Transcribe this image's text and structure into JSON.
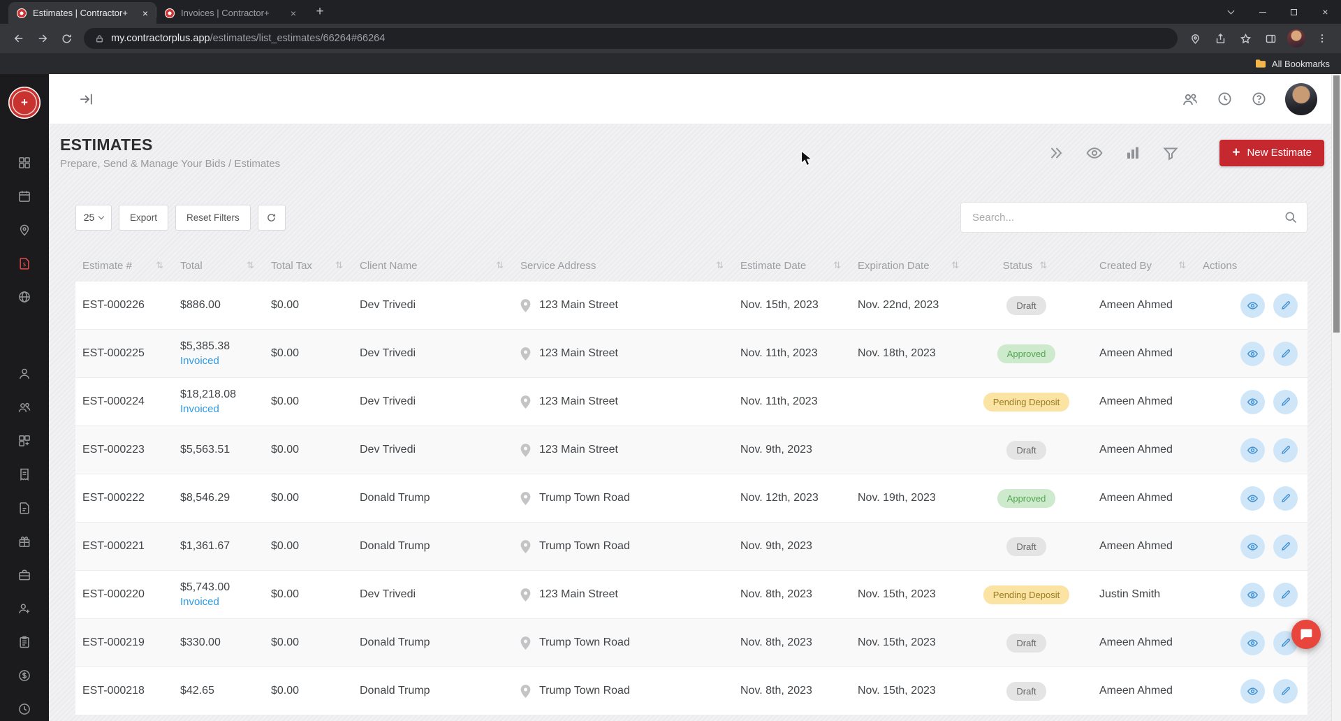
{
  "browser": {
    "tabs": [
      {
        "title": "Estimates | Contractor+",
        "active": true
      },
      {
        "title": "Invoices | Contractor+",
        "active": false
      }
    ],
    "url": {
      "domain": "my.contractorplus.app",
      "path": "/estimates/list_estimates/66264#66264"
    },
    "bookmarks": {
      "all_bookmarks_label": "All Bookmarks"
    }
  },
  "sidebar": {
    "items": [
      {
        "id": "dashboard",
        "icon": "dashboard-icon"
      },
      {
        "id": "schedule",
        "icon": "calendar-icon"
      },
      {
        "id": "jobs",
        "icon": "map-pin-icon"
      },
      {
        "id": "estimates",
        "icon": "estimate-document-icon",
        "active": true
      },
      {
        "id": "network",
        "icon": "globe-icon"
      },
      {
        "id": "clients",
        "icon": "client-icon",
        "gap": true
      },
      {
        "id": "team",
        "icon": "team-icon"
      },
      {
        "id": "items",
        "icon": "items-grid-icon"
      },
      {
        "id": "invoices",
        "icon": "invoice-icon"
      },
      {
        "id": "payments",
        "icon": "payment-document-icon"
      },
      {
        "id": "supplies",
        "icon": "gift-box-icon"
      },
      {
        "id": "tools",
        "icon": "briefcase-icon"
      },
      {
        "id": "leads",
        "icon": "person-add-icon"
      },
      {
        "id": "tasks",
        "icon": "clipboard-icon"
      },
      {
        "id": "expenses",
        "icon": "dollar-coin-icon"
      },
      {
        "id": "timeclock",
        "icon": "clock-icon"
      }
    ]
  },
  "page": {
    "title": "ESTIMATES",
    "subtitle": "Prepare, Send & Manage Your Bids / Estimates",
    "new_estimate_label": "New Estimate"
  },
  "controls": {
    "page_size": "25",
    "export_label": "Export",
    "reset_filters_label": "Reset Filters",
    "search_placeholder": "Search..."
  },
  "table": {
    "invoiced_label": "Invoiced",
    "columns": [
      {
        "key": "est",
        "label": "Estimate #",
        "sortable": true
      },
      {
        "key": "total",
        "label": "Total",
        "sortable": true
      },
      {
        "key": "tax",
        "label": "Total Tax",
        "sortable": true
      },
      {
        "key": "client",
        "label": "Client Name",
        "sortable": true
      },
      {
        "key": "address",
        "label": "Service Address",
        "sortable": true
      },
      {
        "key": "estdate",
        "label": "Estimate Date",
        "sortable": true
      },
      {
        "key": "expdate",
        "label": "Expiration Date",
        "sortable": true
      },
      {
        "key": "status",
        "label": "Status",
        "sortable": true
      },
      {
        "key": "created",
        "label": "Created By",
        "sortable": true
      },
      {
        "key": "actions",
        "label": "Actions",
        "sortable": false
      }
    ],
    "rows": [
      {
        "estimate": "EST-000226",
        "total": "$886.00",
        "invoiced": false,
        "tax": "$0.00",
        "client": "Dev Trivedi",
        "address": "123 Main Street",
        "estimate_date": "Nov. 15th, 2023",
        "expiration_date": "Nov. 22nd, 2023",
        "status": "Draft",
        "status_type": "draft",
        "created_by": "Ameen Ahmed"
      },
      {
        "estimate": "EST-000225",
        "total": "$5,385.38",
        "invoiced": true,
        "tax": "$0.00",
        "client": "Dev Trivedi",
        "address": "123 Main Street",
        "estimate_date": "Nov. 11th, 2023",
        "expiration_date": "Nov. 18th, 2023",
        "status": "Approved",
        "status_type": "approved",
        "created_by": "Ameen Ahmed"
      },
      {
        "estimate": "EST-000224",
        "total": "$18,218.08",
        "invoiced": true,
        "tax": "$0.00",
        "client": "Dev Trivedi",
        "address": "123 Main Street",
        "estimate_date": "Nov. 11th, 2023",
        "expiration_date": "",
        "status": "Pending Deposit",
        "status_type": "pending",
        "created_by": "Ameen Ahmed"
      },
      {
        "estimate": "EST-000223",
        "total": "$5,563.51",
        "invoiced": false,
        "tax": "$0.00",
        "client": "Dev Trivedi",
        "address": "123 Main Street",
        "estimate_date": "Nov. 9th, 2023",
        "expiration_date": "",
        "status": "Draft",
        "status_type": "draft",
        "created_by": "Ameen Ahmed"
      },
      {
        "estimate": "EST-000222",
        "total": "$8,546.29",
        "invoiced": false,
        "tax": "$0.00",
        "client": "Donald Trump",
        "address": "Trump Town Road",
        "estimate_date": "Nov. 12th, 2023",
        "expiration_date": "Nov. 19th, 2023",
        "status": "Approved",
        "status_type": "approved",
        "created_by": "Ameen Ahmed"
      },
      {
        "estimate": "EST-000221",
        "total": "$1,361.67",
        "invoiced": false,
        "tax": "$0.00",
        "client": "Donald Trump",
        "address": "Trump Town Road",
        "estimate_date": "Nov. 9th, 2023",
        "expiration_date": "",
        "status": "Draft",
        "status_type": "draft",
        "created_by": "Ameen Ahmed"
      },
      {
        "estimate": "EST-000220",
        "total": "$5,743.00",
        "invoiced": true,
        "tax": "$0.00",
        "client": "Dev Trivedi",
        "address": "123 Main Street",
        "estimate_date": "Nov. 8th, 2023",
        "expiration_date": "Nov. 15th, 2023",
        "status": "Pending Deposit",
        "status_type": "pending",
        "created_by": "Justin Smith"
      },
      {
        "estimate": "EST-000219",
        "total": "$330.00",
        "invoiced": false,
        "tax": "$0.00",
        "client": "Donald Trump",
        "address": "Trump Town Road",
        "estimate_date": "Nov. 8th, 2023",
        "expiration_date": "Nov. 15th, 2023",
        "status": "Draft",
        "status_type": "draft",
        "created_by": "Ameen Ahmed"
      },
      {
        "estimate": "EST-000218",
        "total": "$42.65",
        "invoiced": false,
        "tax": "$0.00",
        "client": "Donald Trump",
        "address": "Trump Town Road",
        "estimate_date": "Nov. 8th, 2023",
        "expiration_date": "Nov. 15th, 2023",
        "status": "Draft",
        "status_type": "draft",
        "created_by": "Ameen Ahmed"
      }
    ]
  },
  "colors": {
    "accent_red": "#c5282f",
    "link_blue": "#2e9be6",
    "action_button_bg": "#cfe6f9",
    "action_button_icon": "#3f8fd4",
    "status": {
      "draft_bg": "#e4e4e4",
      "draft_text": "#666666",
      "approved_bg": "#cdeacc",
      "approved_text": "#53a653",
      "pending_bg": "#fbe3a4",
      "pending_text": "#9a7d20"
    }
  }
}
